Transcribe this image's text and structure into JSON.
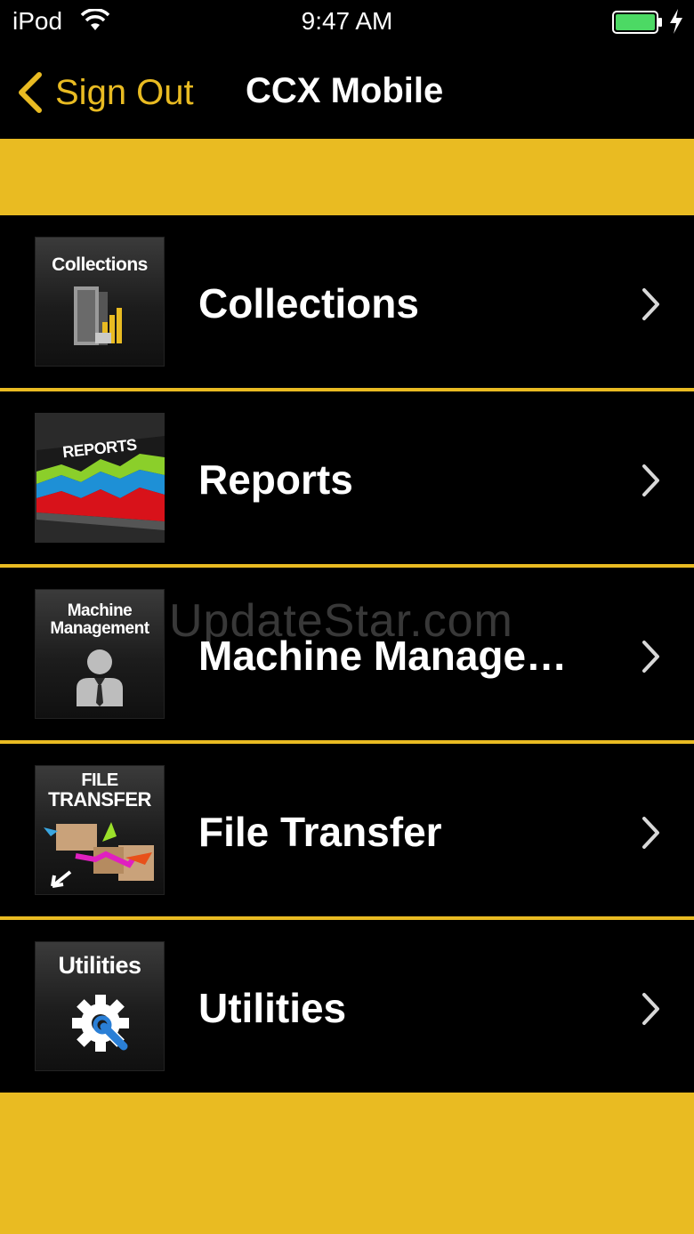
{
  "status_bar": {
    "carrier": "iPod",
    "time": "9:47 AM"
  },
  "nav": {
    "back_label": "Sign Out",
    "title": "CCX Mobile"
  },
  "menu": [
    {
      "label": "Collections",
      "icon_caption": "Collections",
      "icon": "collections-icon"
    },
    {
      "label": "Reports",
      "icon_caption": "REPORTS",
      "icon": "reports-icon"
    },
    {
      "label": "Machine Manage…",
      "icon_caption_line1": "Machine",
      "icon_caption_line2": "Management",
      "icon": "machine-management-icon"
    },
    {
      "label": "File Transfer",
      "icon_caption_line1": "FILE",
      "icon_caption_line2": "TRANSFER",
      "icon": "file-transfer-icon"
    },
    {
      "label": "Utilities",
      "icon_caption": "Utilities",
      "icon": "utilities-icon"
    }
  ],
  "watermark": "UpdateStar.com",
  "colors": {
    "accent": "#e9bb22",
    "background": "#000000"
  }
}
